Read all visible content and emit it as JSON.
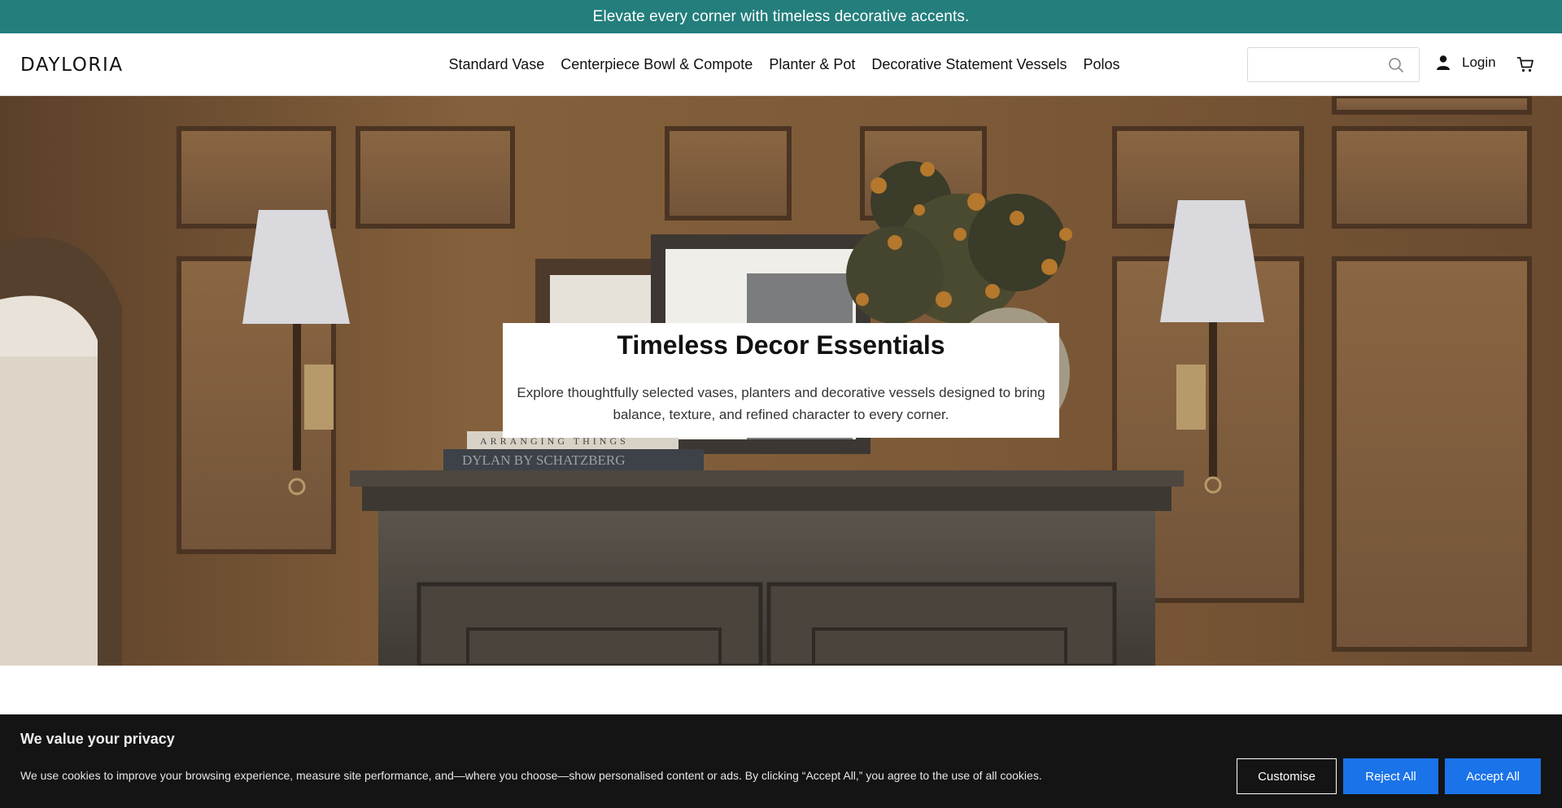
{
  "announcement": "Elevate every corner with timeless decorative accents.",
  "header": {
    "logo": "DAYLORIA",
    "nav": [
      "Standard Vase",
      "Centerpiece Bowl & Compote",
      "Planter & Pot",
      "Decorative Statement Vessels",
      "Polos"
    ],
    "search_placeholder": "",
    "login_label": "Login"
  },
  "hero": {
    "title": "Timeless Decor Essentials",
    "description": "Explore thoughtfully selected vases, planters and decorative vessels designed to bring balance, texture, and refined character to every corner.",
    "book_titles": [
      "ARRANGING THINGS",
      "DYLAN BY SCHATZBERG"
    ]
  },
  "cookie": {
    "title": "We value your privacy",
    "text": "We use cookies to improve your browsing experience, measure site performance, and—where you choose—show personalised content or ads. By clicking “Accept All,” you agree to the use of all cookies.",
    "customise_label": "Customise",
    "reject_label": "Reject All",
    "accept_label": "Accept All"
  },
  "icons": {
    "search": "search-icon",
    "user": "user-icon",
    "cart": "cart-icon"
  },
  "colors": {
    "announcement_bg": "#237e7c",
    "button_blue": "#1a73e8",
    "cookie_bg": "#141414"
  }
}
